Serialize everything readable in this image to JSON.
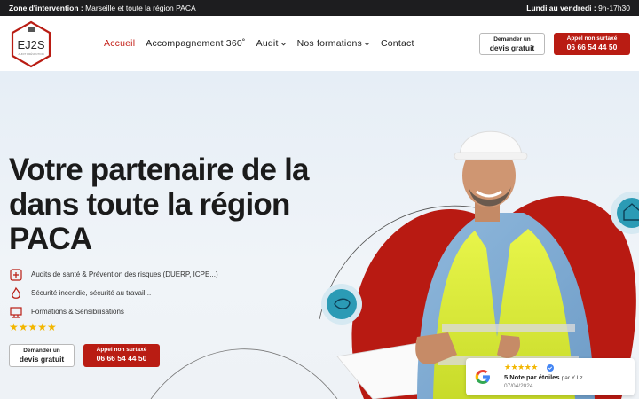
{
  "topbar": {
    "zone_label": "Zone d'intervention :",
    "zone_value": "Marseille et toute la région PACA",
    "hours_label": "Lundi au vendredi :",
    "hours_value": "9h-17h30"
  },
  "logo": {
    "text": "EJ2S",
    "sub": "AUDIT PRÉVENTION"
  },
  "nav": {
    "items": [
      {
        "label": "Accueil"
      },
      {
        "label": "Accompagnement 360˚"
      },
      {
        "label": "Audit"
      },
      {
        "label": "Nos formations"
      },
      {
        "label": "Contact"
      }
    ]
  },
  "header_cta": {
    "quote_l1": "Demander un",
    "quote_l2": "devis gratuit",
    "call_l1": "Appel non surtaxé",
    "call_l2": "06 66 54 44 50"
  },
  "hero": {
    "headline": "Votre partenaire de la dans toute la région PACA",
    "features": [
      "Audits de santé & Prévention des risques (DUERP, ICPE...)",
      "Sécurité incendie, sécurité au travail...",
      "Formations & Sensibilisations"
    ],
    "stars": "★★★★★",
    "quote_l1": "Demander un",
    "quote_l2": "devis gratuit",
    "call_l1": "Appel non surtaxé",
    "call_l2": "06 66 54 44 50"
  },
  "review": {
    "stars": "★★★★★",
    "note": "5 Note par étoiles",
    "by": "par Y Lz",
    "date": "07/04/2024"
  },
  "colors": {
    "brand_red": "#b91c13",
    "star": "#f2b600",
    "topbar": "#1d1d1f",
    "accent_teal": "#2b9bb5"
  }
}
